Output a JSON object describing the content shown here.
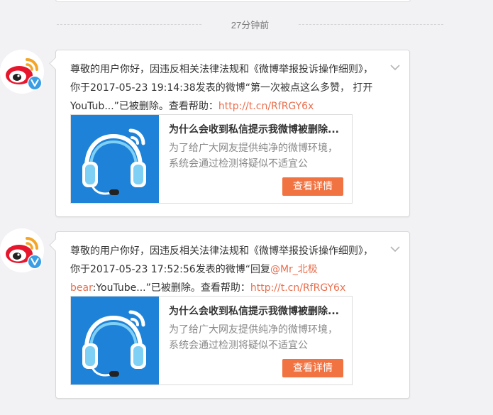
{
  "time_divider": "27分钟前",
  "messages": [
    {
      "text_a": "尊敬的用户你好，因违反相关法律法规和《微博举报投诉操作细则》，你于2017-05-23 19:14:38发表的微博“第一次被点这么多赞， 打开YouTub...”已被删除。查看帮助：",
      "mention": "",
      "text_b": "",
      "link": "http://t.cn/RfRGY6x",
      "card_title": "为什么会收到私信提示我微博被删除...",
      "card_desc": "为了给广大网友提供纯净的微博环境，系统会通过检测将疑似不适宜公",
      "card_button": "查看详情"
    },
    {
      "text_a": "尊敬的用户你好，因违反相关法律法规和《微博举报投诉操作细则》，你于2017-05-23 17:52:56发表的微博“回复",
      "mention": "@Mr_北极bear",
      "text_b": ":YouTube...”已被删除。查看帮助：",
      "link": "http://t.cn/RfRGY6x",
      "card_title": "为什么会收到私信提示我微博被删除...",
      "card_desc": "为了给广大网友提供纯净的微博环境，系统会通过检测将疑似不适宜公",
      "card_button": "查看详情"
    }
  ],
  "colors": {
    "background": "#f2f2f5",
    "link": "#eb6f4e",
    "button": "#f07341",
    "thumb_bg": "#1e83d8",
    "verified_badge": "#3a9ee4"
  },
  "icons": [
    "weibo-logo-icon",
    "verified-badge-icon",
    "chevron-down-icon",
    "headphones-icon"
  ]
}
